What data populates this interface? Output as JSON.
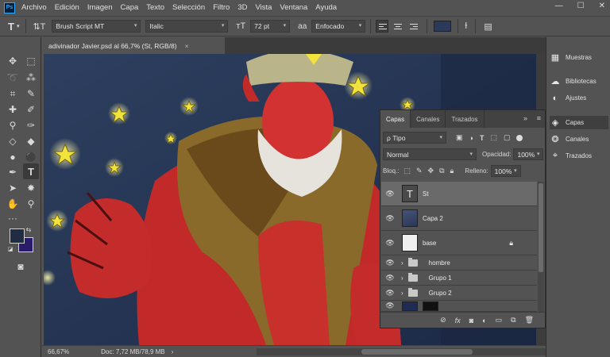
{
  "app": {
    "logo": "Ps"
  },
  "menu": [
    "Archivo",
    "Edición",
    "Imagen",
    "Capa",
    "Texto",
    "Selección",
    "Filtro",
    "3D",
    "Vista",
    "Ventana",
    "Ayuda"
  ],
  "window_controls": {
    "minimize": "—",
    "maximize": "☐",
    "close": "✕"
  },
  "options": {
    "font_family": "Brush Script MT",
    "font_style": "Italic",
    "font_size": "72 pt",
    "antialias": "Enfocado",
    "text_color": "#2b3a5a"
  },
  "document": {
    "tab_title": "adivinador Javier.psd al 66,7% (St, RGB/8)",
    "tab_close": "×",
    "zoom": "66,67%",
    "doc_info": "Doc: 7,72 MB/78,9 MB"
  },
  "colors": {
    "foreground": "#1f2c44",
    "background": "#2a1b6b"
  },
  "dock": [
    {
      "label": "Muestras",
      "icon": "grid-icon"
    },
    {
      "label": "Bibliotecas",
      "icon": "cloud-icon"
    },
    {
      "label": "Ajustes",
      "icon": "adjust-icon"
    },
    {
      "label": "Capas",
      "icon": "layers-icon"
    },
    {
      "label": "Canales",
      "icon": "channels-icon"
    },
    {
      "label": "Trazados",
      "icon": "paths-icon"
    }
  ],
  "layers_panel": {
    "tabs": [
      "Capas",
      "Canales",
      "Trazados"
    ],
    "filter_label": "ρ Tipo",
    "blend_mode": "Normal",
    "opacity_label": "Opacidad:",
    "opacity_value": "100%",
    "lock_label": "Bloq.:",
    "fill_label": "Relleno:",
    "fill_value": "100%",
    "layers": [
      {
        "name": "St",
        "kind": "text",
        "selected": true
      },
      {
        "name": "Capa 2",
        "kind": "image",
        "selected": false
      },
      {
        "name": "base",
        "kind": "image",
        "selected": false,
        "locked": true
      },
      {
        "name": "hombre",
        "kind": "group",
        "selected": false
      },
      {
        "name": "Grupo 1",
        "kind": "group",
        "selected": false
      },
      {
        "name": "Grupo 2",
        "kind": "group",
        "selected": false
      }
    ]
  }
}
